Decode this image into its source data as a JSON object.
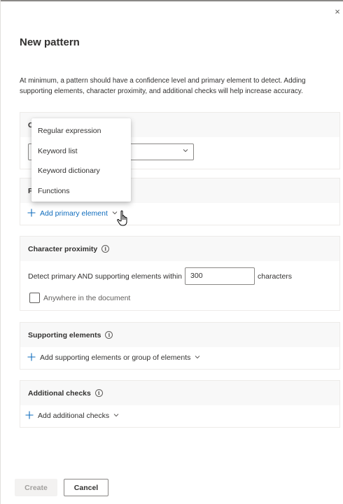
{
  "panel": {
    "close_glyph": "×",
    "title": "New pattern",
    "intro": "At minimum, a pattern should have a confidence level and primary element to detect. Adding supporting elements, character proximity, and additional checks will help increase accuracy."
  },
  "confidence": {
    "title_visible": "C",
    "select_value": ""
  },
  "primary": {
    "title_visible": "P",
    "add_label": "Add primary element"
  },
  "dropdown_menu": {
    "items": [
      "Regular expression",
      "Keyword list",
      "Keyword dictionary",
      "Functions"
    ]
  },
  "proximity": {
    "title": "Character proximity",
    "info": "i",
    "prefix": "Detect primary AND supporting elements within",
    "value": "300",
    "suffix": "characters",
    "checkbox_label": "Anywhere in the document"
  },
  "supporting": {
    "title": "Supporting elements",
    "info": "i",
    "add_label": "Add supporting elements or group of elements"
  },
  "additional": {
    "title": "Additional checks",
    "info": "i",
    "add_label": "Add additional checks"
  },
  "footer": {
    "create_label": "Create",
    "cancel_label": "Cancel"
  },
  "icons": {
    "plus": "plus-icon",
    "chevron": "chevron-down-icon",
    "info": "info-icon",
    "cursor": "hand-pointer-icon"
  },
  "colors": {
    "link": "#0f6cbd",
    "section_header_bg": "#f8f8f8",
    "border": "#edebe9"
  }
}
